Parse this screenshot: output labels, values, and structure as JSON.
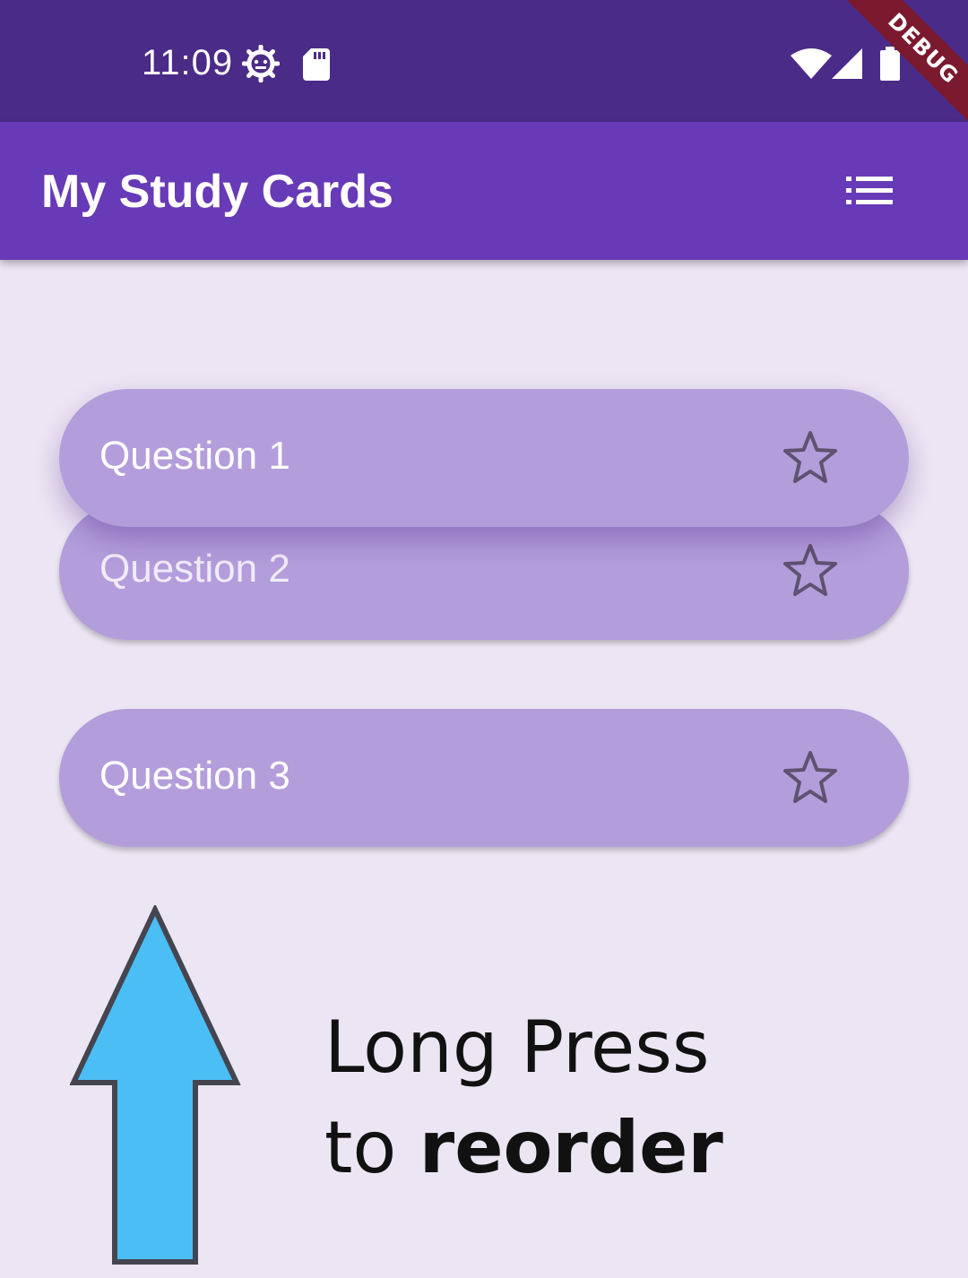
{
  "status_bar": {
    "time": "11:09",
    "icons": [
      "settings-gear-icon",
      "sd-card-icon",
      "wifi-icon",
      "cell-signal-icon",
      "battery-icon"
    ],
    "background": "#4a2b87"
  },
  "debug_banner": {
    "label": "DEBUG",
    "color": "#7b1a2f"
  },
  "app_bar": {
    "title": "My Study Cards",
    "action_icon": "list-icon",
    "background": "#673ab7"
  },
  "cards": [
    {
      "label": "Question 1",
      "icon": "star-outline-icon",
      "state": "dragging"
    },
    {
      "label": "Question 2",
      "icon": "star-outline-icon",
      "state": "under-dragged"
    },
    {
      "label": "Question 3",
      "icon": "star-outline-icon",
      "state": "normal"
    }
  ],
  "card_color": "#b39ddb",
  "hint": {
    "line1": "Long Press",
    "line2_prefix": "to",
    "line2_bold": "reorder",
    "arrow_icon": "up-arrow-icon",
    "arrow_color": "#4bbef5"
  }
}
